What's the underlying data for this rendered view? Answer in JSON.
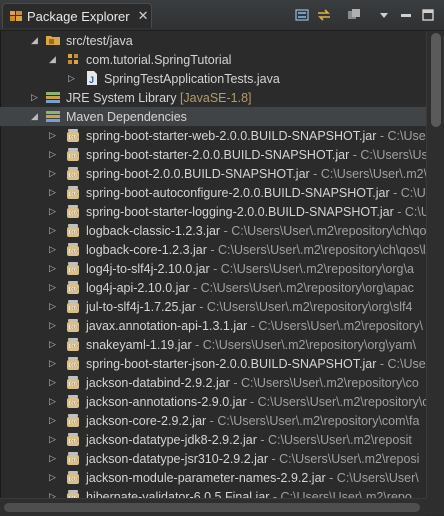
{
  "tab": {
    "title": "Package Explorer",
    "close": "✕"
  },
  "toolbar": [
    "collapse-all-icon",
    "link-with-editor-icon",
    "view-options-icon",
    "view-menu-icon",
    "minimize-icon",
    "maximize-icon"
  ],
  "tree": {
    "src_test_java": "src/test/java",
    "package": "com.tutorial.SpringTutorial",
    "test_file": "SpringTestApplicationTests.java",
    "jre": {
      "label": "JRE System Library",
      "decoration": "[JavaSE-1.8]"
    },
    "maven": "Maven Dependencies",
    "jars": [
      {
        "name": "spring-boot-starter-web-2.0.0.BUILD-SNAPSHOT.jar",
        "path": "C:\\Users"
      },
      {
        "name": "spring-boot-starter-2.0.0.BUILD-SNAPSHOT.jar",
        "path": "C:\\Users\\User\\.m"
      },
      {
        "name": "spring-boot-2.0.0.BUILD-SNAPSHOT.jar",
        "path": "C:\\Users\\User\\.m2\\repo"
      },
      {
        "name": "spring-boot-autoconfigure-2.0.0.BUILD-SNAPSHOT.jar",
        "path": "C:\\Users"
      },
      {
        "name": "spring-boot-starter-logging-2.0.0.BUILD-SNAPSHOT.jar",
        "path": "C:\\Users"
      },
      {
        "name": "logback-classic-1.2.3.jar",
        "path": "C:\\Users\\User\\.m2\\repository\\ch\\qo"
      },
      {
        "name": "logback-core-1.2.3.jar",
        "path": "C:\\Users\\User\\.m2\\repository\\ch\\qos\\l"
      },
      {
        "name": "log4j-to-slf4j-2.10.0.jar",
        "path": "C:\\Users\\User\\.m2\\repository\\org\\a"
      },
      {
        "name": "log4j-api-2.10.0.jar",
        "path": "C:\\Users\\User\\.m2\\repository\\org\\apac"
      },
      {
        "name": "jul-to-slf4j-1.7.25.jar",
        "path": "C:\\Users\\User\\.m2\\repository\\org\\slf4"
      },
      {
        "name": "javax.annotation-api-1.3.1.jar",
        "path": "C:\\Users\\User\\.m2\\repository\\"
      },
      {
        "name": "snakeyaml-1.19.jar",
        "path": "C:\\Users\\User\\.m2\\repository\\org\\yam\\"
      },
      {
        "name": "spring-boot-starter-json-2.0.0.BUILD-SNAPSHOT.jar",
        "path": "C:\\Users\\U"
      },
      {
        "name": "jackson-databind-2.9.2.jar",
        "path": "C:\\Users\\User\\.m2\\repository\\co"
      },
      {
        "name": "jackson-annotations-2.9.0.jar",
        "path": "C:\\Users\\User\\.m2\\repository\\c"
      },
      {
        "name": "jackson-core-2.9.2.jar",
        "path": "C:\\Users\\User\\.m2\\repository\\com\\fa"
      },
      {
        "name": "jackson-datatype-jdk8-2.9.2.jar",
        "path": "C:\\Users\\User\\.m2\\reposit"
      },
      {
        "name": "jackson-datatype-jsr310-2.9.2.jar",
        "path": "C:\\Users\\User\\.m2\\reposi"
      },
      {
        "name": "jackson-module-parameter-names-2.9.2.jar",
        "path": "C:\\Users\\User\\"
      },
      {
        "name": "hibernate-validator-6.0.5.Final.jar",
        "path": "C:\\Users\\User\\.m2\\repo"
      }
    ]
  }
}
